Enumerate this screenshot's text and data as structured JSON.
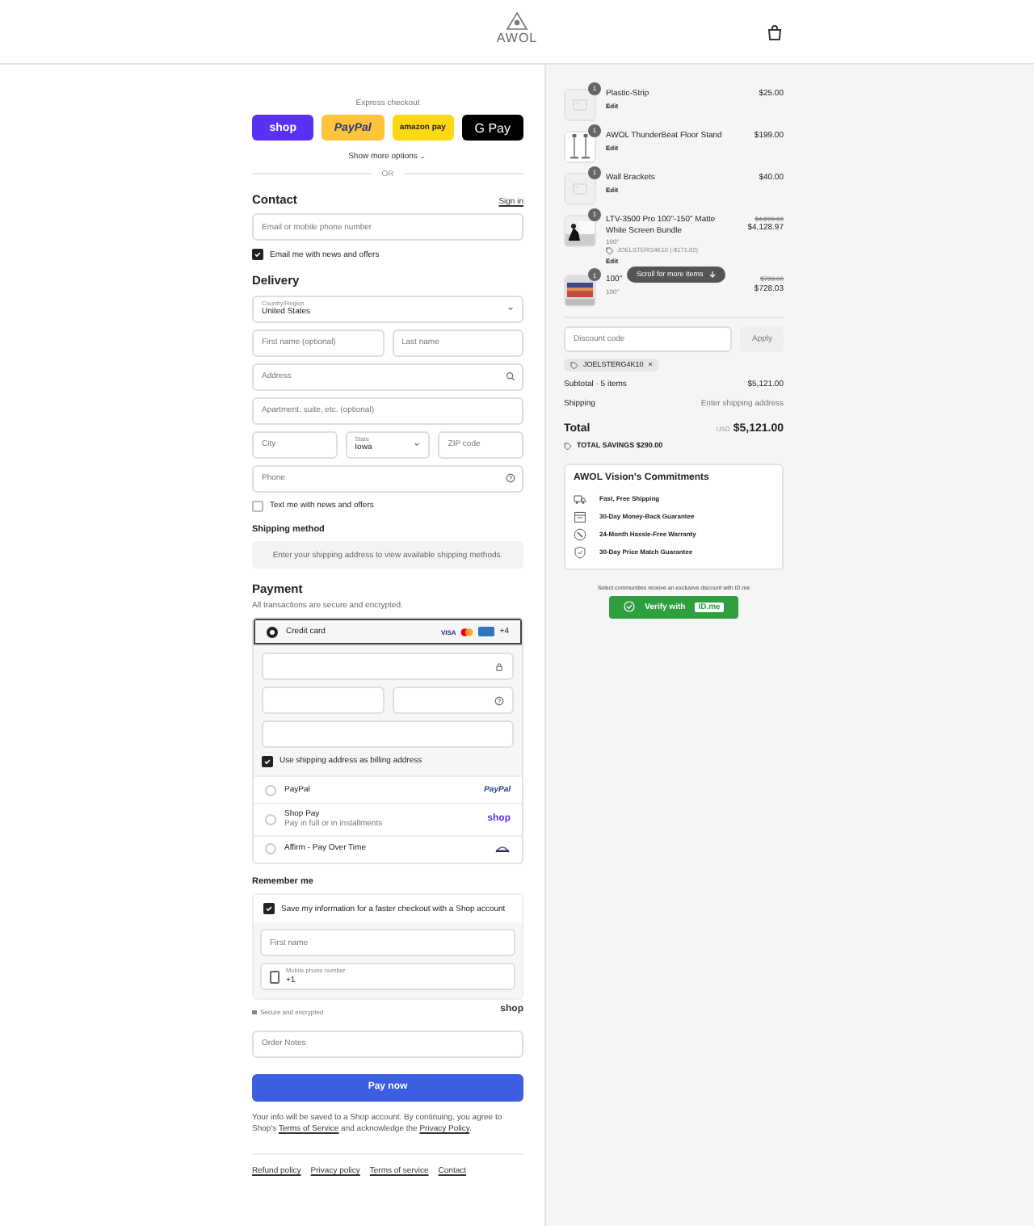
{
  "header": {
    "logo": "AWOL"
  },
  "express_checkout": {
    "label": "Express checkout",
    "buttons": [
      {
        "kind": "shop",
        "label": "shop"
      },
      {
        "kind": "paypal",
        "label": "PayPal"
      },
      {
        "kind": "amazon",
        "label": "amazon pay"
      },
      {
        "kind": "gpay",
        "label": "G Pay"
      }
    ],
    "show_more": "Show more options",
    "divider": "OR"
  },
  "contact": {
    "title": "Contact",
    "sign_in": "Sign in",
    "email": {
      "placeholder": "Email or mobile phone number"
    },
    "newsletter": {
      "label": "Email me with news and offers",
      "checked": true
    }
  },
  "delivery": {
    "title": "Delivery",
    "rows": [
      [
        {
          "kind": "select",
          "label": "Country/Region",
          "value": "United States"
        }
      ],
      [
        {
          "kind": "text",
          "placeholder": "First name (optional)"
        },
        {
          "kind": "text",
          "placeholder": "Last name"
        }
      ],
      [
        {
          "kind": "search",
          "placeholder": "Address"
        }
      ],
      [
        {
          "kind": "text",
          "placeholder": "Apartment, suite, etc. (optional)"
        }
      ],
      [
        {
          "kind": "text",
          "placeholder": "City"
        },
        {
          "kind": "select",
          "label": "State",
          "value": "Iowa"
        },
        {
          "kind": "text",
          "placeholder": "ZIP code"
        }
      ],
      [
        {
          "kind": "help",
          "placeholder": "Phone"
        }
      ]
    ],
    "text_me": {
      "label": "Text me with news and offers",
      "checked": false
    }
  },
  "shipping_method": {
    "title": "Shipping method",
    "message": "Enter your shipping address to view available shipping methods."
  },
  "payment": {
    "title": "Payment",
    "subtitle": "All transactions are secure and encrypted.",
    "methods": [
      {
        "kind": "card",
        "label": "Credit card",
        "brands": [
          "VISA",
          "+4"
        ],
        "selected": true
      },
      {
        "kind": "paypal",
        "label": "PayPal",
        "logo": "PayPal",
        "selected": false
      },
      {
        "kind": "shop",
        "label": "Shop Pay",
        "sub": "Pay in full or in installments",
        "logo": "shop",
        "selected": false
      },
      {
        "kind": "affirm",
        "label": "Affirm - Pay Over Time",
        "selected": false
      }
    ],
    "billing": {
      "label": "Use shipping address as billing address",
      "checked": true
    }
  },
  "remember_me": {
    "title": "Remember me",
    "save": {
      "label": "Save my information for a faster checkout with a Shop account",
      "checked": true
    },
    "first_name": {
      "placeholder": "First name"
    },
    "mobile": {
      "label": "Mobile phone number",
      "value": "+1"
    },
    "secure": "Secure and encrypted",
    "logo": "shop"
  },
  "order_notes": {
    "placeholder": "Order Notes"
  },
  "pay_button": "Pay now",
  "legal": {
    "before": "Your info will be saved to a Shop account. By continuing, you agree to Shop's",
    "terms": "Terms of Service",
    "middle": "and acknowledge the",
    "privacy": "Privacy Policy",
    "after": "."
  },
  "footer_links": [
    "Refund policy",
    "Privacy policy",
    "Terms of service",
    "Contact"
  ],
  "order_summary": {
    "items": [
      {
        "qty": "1",
        "name": "Plastic-Strip",
        "edit": "Edit",
        "price": "$25.00"
      },
      {
        "qty": "1",
        "name": "AWOL ThunderBeat Floor Stand",
        "edit": "Edit",
        "price": "$199.00"
      },
      {
        "qty": "1",
        "name": "Wall Brackets",
        "edit": "Edit",
        "price": "$40.00"
      },
      {
        "qty": "1",
        "name": "LTV-3500 Pro 100\"-150\" Matte White Screen Bundle",
        "variant": "100\"",
        "discount": "JOELSTERG4K10 (-$171.02)",
        "edit": "Edit",
        "compare_price": "$4,299.99",
        "price": "$4,128.97"
      },
      {
        "qty": "1",
        "name": "100\"",
        "variant": "100\"",
        "compare_price": "$799.00",
        "price": "$728.03"
      }
    ],
    "scroll_hint": "Scroll for more items",
    "discount": {
      "placeholder": "Discount code",
      "apply": "Apply"
    },
    "code_tag": {
      "label": "JOELSTERG4K10",
      "remove": "×"
    },
    "subtotal": {
      "label": "Subtotal · 5 items",
      "value": "$5,121.00"
    },
    "shipping": {
      "label": "Shipping",
      "value": "Enter shipping address"
    },
    "total": {
      "label": "Total",
      "currency": "USD",
      "value": "$5,121.00"
    },
    "savings": "TOTAL SAVINGS $290.00",
    "commitments": {
      "title": "AWOL Vision's Commitments",
      "items": [
        "Fast, Free Shipping",
        "30-Day Money-Back Guarantee",
        "24-Month Hassle-Free Warranty",
        "30-Day Price Match Guarantee"
      ]
    },
    "promo": "Select communities receive an exclusive discount with ID.me",
    "verify": {
      "label": "Verify with",
      "brand": "ID.me"
    }
  }
}
